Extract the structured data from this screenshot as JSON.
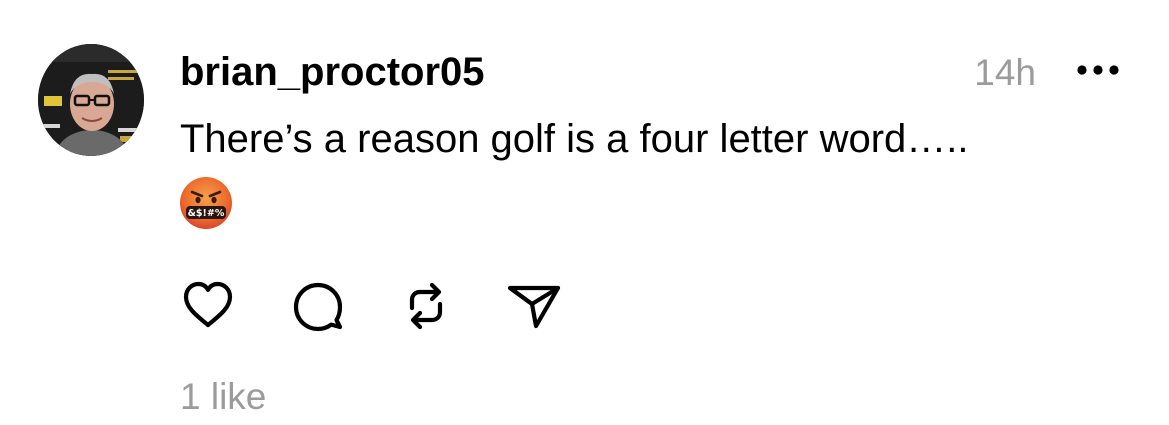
{
  "post": {
    "author": {
      "username": "brian_proctor05",
      "avatar_icon": "avatar-photo-icon"
    },
    "timestamp": "14h",
    "text": "There’s a reason golf is a four letter word…..",
    "emoji": {
      "name": "face-with-symbols-on-mouth-emoji",
      "symbols": "&$!#%"
    },
    "actions": {
      "like_icon": "heart-icon",
      "reply_icon": "comment-icon",
      "repost_icon": "repost-icon",
      "share_icon": "send-icon",
      "more_icon": "more-options-icon"
    },
    "likes_label": "1 like"
  },
  "colors": {
    "text": "#000000",
    "muted": "#9b9b9b",
    "background": "#ffffff",
    "emoji_face": "#e8572a"
  }
}
